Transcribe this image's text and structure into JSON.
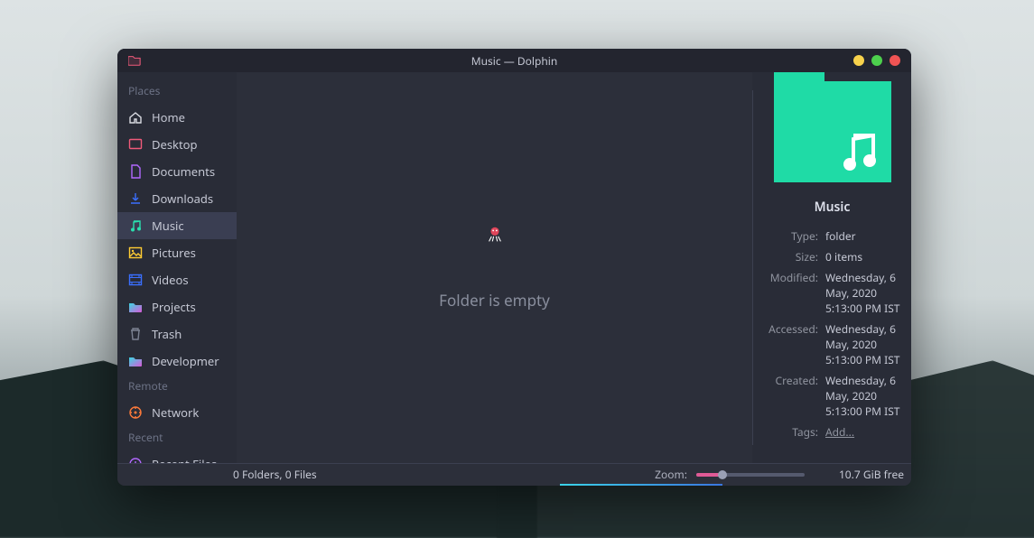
{
  "window": {
    "title": "Music — Dolphin"
  },
  "sidebar": {
    "sections": [
      {
        "header": "Places",
        "items": [
          {
            "icon": "home",
            "label": "Home"
          },
          {
            "icon": "desk",
            "label": "Desktop"
          },
          {
            "icon": "docs",
            "label": "Documents"
          },
          {
            "icon": "down",
            "label": "Downloads"
          },
          {
            "icon": "music",
            "label": "Music",
            "selected": true
          },
          {
            "icon": "pics",
            "label": "Pictures"
          },
          {
            "icon": "vids",
            "label": "Videos"
          },
          {
            "icon": "proj",
            "label": "Projects"
          },
          {
            "icon": "trash",
            "label": "Trash"
          },
          {
            "icon": "dev",
            "label": "Developmer"
          }
        ]
      },
      {
        "header": "Remote",
        "items": [
          {
            "icon": "net",
            "label": "Network"
          }
        ]
      },
      {
        "header": "Recent",
        "items": [
          {
            "icon": "recent",
            "label": "Recent Files"
          }
        ]
      }
    ]
  },
  "main": {
    "empty_text": "Folder is empty"
  },
  "info": {
    "title": "Music",
    "rows": [
      {
        "k": "Type:",
        "v": "folder"
      },
      {
        "k": "Size:",
        "v": "0 items"
      },
      {
        "k": "Modified:",
        "v": "Wednesday, 6 May, 2020 5:13:00 PM IST"
      },
      {
        "k": "Accessed:",
        "v": "Wednesday, 6 May, 2020 5:13:00 PM IST"
      },
      {
        "k": "Created:",
        "v": "Wednesday, 6 May, 2020 5:13:00 PM IST"
      },
      {
        "k": "Tags:",
        "v": "Add...",
        "link": true
      }
    ]
  },
  "status": {
    "counts": "0 Folders, 0 Files",
    "zoom_label": "Zoom:",
    "free": "10.7 GiB free"
  },
  "icons": {
    "home": "app",
    "colors": {
      "home": "#d9dbe2",
      "desk": "#f05a7a",
      "docs": "#b268ff",
      "down": "#3a6fff",
      "music": "#2adfae",
      "pics": "#ffcc33",
      "vids": "#3a6fff",
      "proj": "#3ad6e2",
      "trash": "#7c8292",
      "dev": "#3ad6e2",
      "net": "#ff7a3a",
      "recent": "#b268ff"
    }
  }
}
